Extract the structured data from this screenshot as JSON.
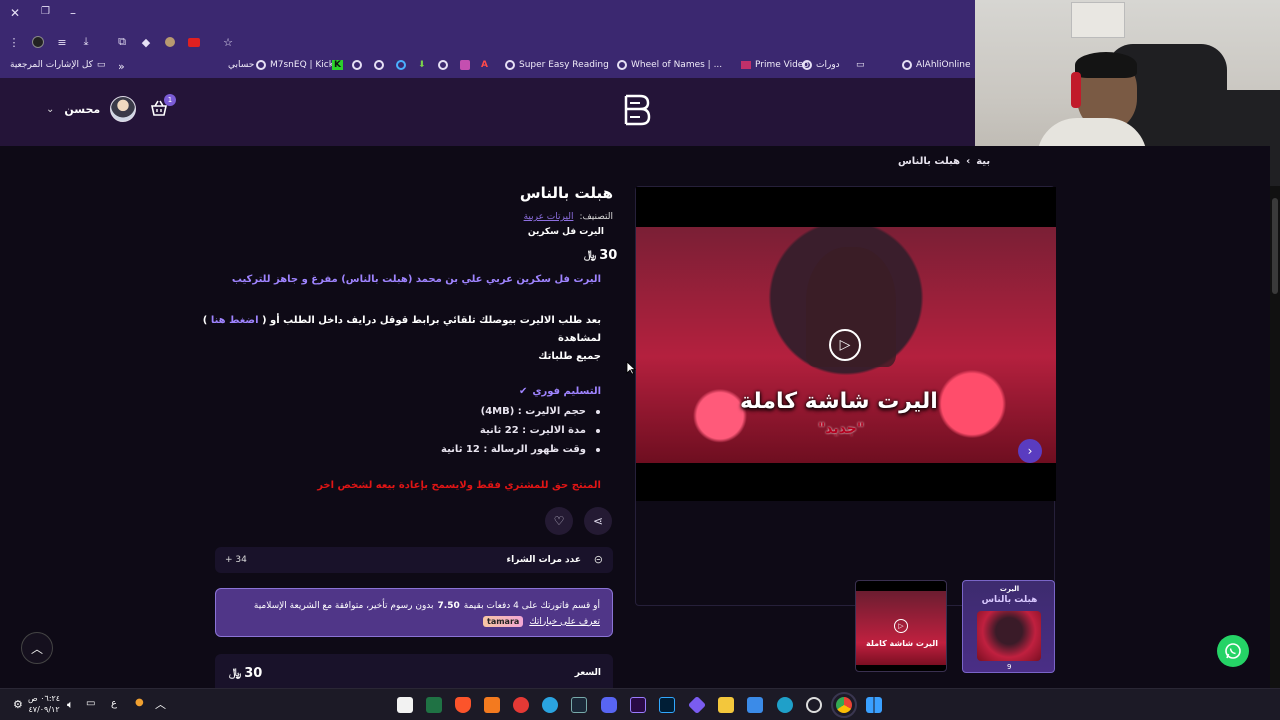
{
  "browser": {
    "bookmarks": [
      {
        "label": "AlAhliOnline"
      },
      {
        "label": "دورات"
      },
      {
        "label": "Prime Video"
      },
      {
        "label": "Wheel of Names | ..."
      },
      {
        "label": "Super Easy Reading"
      },
      {
        "label": "M7snEQ | Kick"
      },
      {
        "label": "حسابي"
      },
      {
        "label": "كل الإشارات المرجعية"
      }
    ],
    "accent": "#3b2870"
  },
  "site": {
    "user_name": "محسن",
    "cart_count": "1",
    "breadcrumb_current": "هبلت بالناس",
    "breadcrumb_parent": "بية"
  },
  "product": {
    "title": "هبلت بالناس",
    "category_label": "التصنيف:",
    "category_value": "اليرتات عربية",
    "subtitle": "اليرت فل سكرين",
    "price": "30",
    "currency": "﷼",
    "description": "اليرت فل سكرين عربي علي بن محمد (هبلت بالناس) مفرغ و جاهز للتركيب",
    "instructions_a": "بعد طلب الاليرت بيوصلك تلقائي برابط قوقل درايف داخل الطلب أو (",
    "instructions_link": "اضغط هنا",
    "instructions_b": ") لمشاهدة",
    "instructions_c": "جميع طلباتك",
    "delivery_label": "التسليم فوري",
    "specs": [
      "حجم الاليرت : (4MB)",
      "مدة الاليرت : 22 ثانية",
      "وقت ظهور الرسالة : 12 ثانية"
    ],
    "warning": "المنتج حق للمشتري فقط ولايسمح بإعادة بيعه لشخص اخر",
    "purchases_label": "عدد مرات الشراء",
    "purchases_value": "+ 34",
    "tamara_text_a": "أو قسم فاتورتك على 4 دفعات بقيمة",
    "tamara_amount": "7.50",
    "tamara_text_b": "بدون رسوم تأخير، متوافقة مع الشريعة الإسلامية",
    "tamara_link": "تعرف على خياراتك",
    "tamara_badge": "tamara",
    "price_label": "السعر",
    "price_row_value": "30"
  },
  "media": {
    "video_caption": "اليرت شاشة كاملة",
    "video_sub": "\"جديد\"",
    "thumb1_caption": "اليرت شاشة كاملة",
    "thumb2_top": "اليرت",
    "thumb2_title": "هبلت بالناس",
    "thumb2_count": "9"
  },
  "taskbar": {
    "time": "٠٦:٢٤ ص",
    "date": "٤٧/٠٩/١٢",
    "lang": "ع"
  }
}
